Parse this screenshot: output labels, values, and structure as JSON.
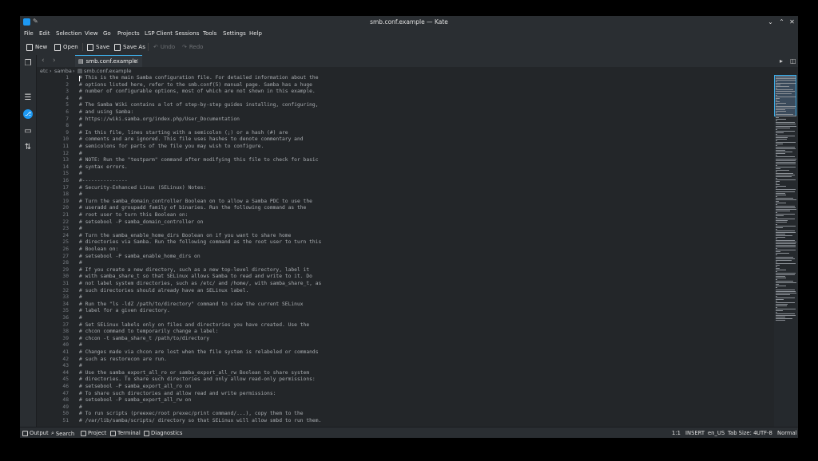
{
  "window": {
    "title": "smb.conf.example — Kate"
  },
  "menu": [
    "File",
    "Edit",
    "Selection",
    "View",
    "Go",
    "Projects",
    "LSP Client",
    "Sessions",
    "Tools",
    "Settings",
    "Help"
  ],
  "toolbar": {
    "new": "New",
    "open": "Open",
    "save": "Save",
    "save_as": "Save As",
    "undo": "Undo",
    "redo": "Redo"
  },
  "tab": {
    "label": "smb.conf.example"
  },
  "breadcrumb": {
    "part1": "etc",
    "part2": "samba",
    "part3": "smb.conf.example"
  },
  "editor": {
    "lines": [
      "# This is the main Samba configuration file. For detailed information about the",
      "# options listed here, refer to the smb.conf(5) manual page. Samba has a huge",
      "# number of configurable options, most of which are not shown in this example.",
      "#",
      "# The Samba Wiki contains a lot of step-by-step guides installing, configuring,",
      "# and using Samba:",
      "# https://wiki.samba.org/index.php/User_Documentation",
      "#",
      "# In this file, lines starting with a semicolon (;) or a hash (#) are",
      "# comments and are ignored. This file uses hashes to denote commentary and",
      "# semicolons for parts of the file you may wish to configure.",
      "#",
      "# NOTE: Run the \"testparm\" command after modifying this file to check for basic",
      "# syntax errors.",
      "#",
      "#---------------",
      "# Security-Enhanced Linux (SELinux) Notes:",
      "#",
      "# Turn the samba_domain_controller Boolean on to allow a Samba PDC to use the",
      "# useradd and groupadd family of binaries. Run the following command as the",
      "# root user to turn this Boolean on:",
      "# setsebool -P samba_domain_controller on",
      "#",
      "# Turn the samba_enable_home_dirs Boolean on if you want to share home",
      "# directories via Samba. Run the following command as the root user to turn this",
      "# Boolean on:",
      "# setsebool -P samba_enable_home_dirs on",
      "#",
      "# If you create a new directory, such as a new top-level directory, label it",
      "# with samba_share_t so that SELinux allows Samba to read and write to it. Do",
      "# not label system directories, such as /etc/ and /home/, with samba_share_t, as",
      "# such directories should already have an SELinux label.",
      "#",
      "# Run the \"ls -ldZ /path/to/directory\" command to view the current SELinux",
      "# label for a given directory.",
      "#",
      "# Set SELinux labels only on files and directories you have created. Use the",
      "# chcon command to temporarily change a label:",
      "# chcon -t samba_share_t /path/to/directory",
      "#",
      "# Changes made via chcon are lost when the file system is relabeled or commands",
      "# such as restorecon are run.",
      "#",
      "# Use the samba_export_all_ro or samba_export_all_rw Boolean to share system",
      "# directories. To share such directories and only allow read-only permissions:",
      "# setsebool -P samba_export_all_ro on",
      "# To share such directories and allow read and write permissions:",
      "# setsebool -P samba_export_all_rw on",
      "#",
      "# To run scripts (preexec/root prexec/print command/...), copy them to the",
      "# /var/lib/samba/scripts/ directory so that SELinux will allow smbd to run them."
    ]
  },
  "statusbar": {
    "output": "Output",
    "search": "Search",
    "project": "Project",
    "terminal": "Terminal",
    "diagnostics": "Diagnostics",
    "position": "1:1",
    "mode": "INSERT",
    "lang": "en_US",
    "tabsize": "Tab Size: 4",
    "encoding": "UTF-8",
    "filetype": "Normal"
  },
  "colors": {
    "accent": "#3daee9",
    "background": "#232629",
    "chrome": "#2a2e32"
  }
}
